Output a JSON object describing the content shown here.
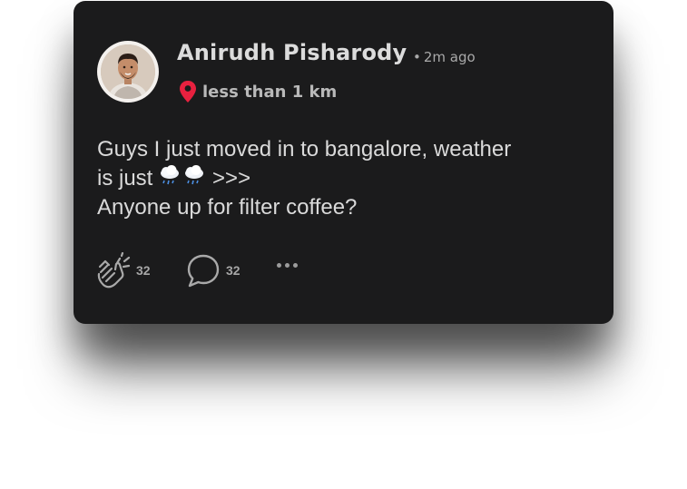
{
  "post": {
    "author_name": "Anirudh Pisharody",
    "time_ago": "2m ago",
    "time_separator": "•",
    "location_text": "less than 1 km",
    "text_line_1": "Guys I just moved in to bangalore, weather",
    "text_line_2_prefix": "is just",
    "text_line_2_suffix": ">>>",
    "text_line_3": "Anyone up for filter coffee?"
  },
  "actions": {
    "clap_count": "32",
    "comment_count": "32"
  },
  "icons": {
    "avatar": "avatar",
    "location": "location-pin-icon",
    "rain_cloud": "cloud-with-rain-icon",
    "clap": "clapping-hands-icon",
    "comment": "comment-bubble-icon",
    "more": "more-options-icon"
  },
  "colors": {
    "card_background": "#1b1b1c",
    "pin_red": "#e8213f",
    "text": "#dadada",
    "muted": "#a7a7a7"
  }
}
